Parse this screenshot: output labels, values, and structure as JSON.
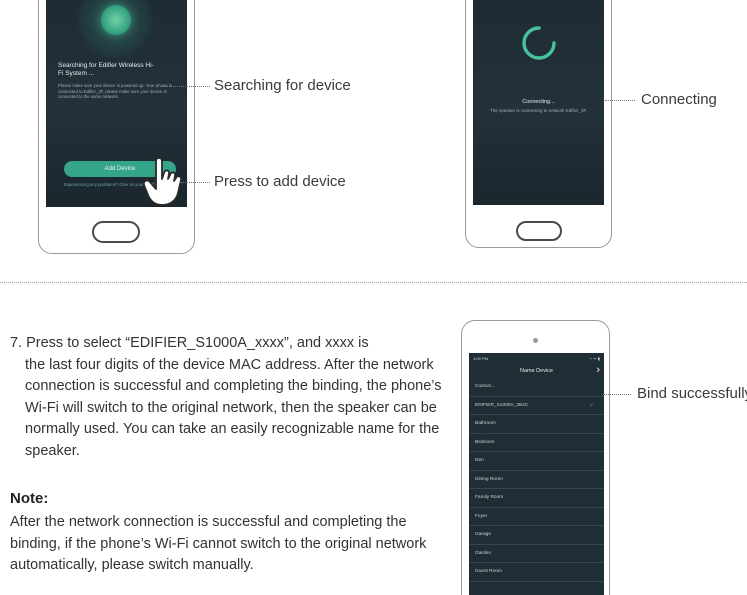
{
  "phone1": {
    "title": "Searching for Edifier Wireless Hi-Fi System ...",
    "description": "Please make sure your device is powered up. Your phone is connected to Edifier_3F, please make sure your device is connected to the same network.",
    "add_button_label": "Add Device",
    "footer": "Experiencing any problems? Give us your feedback >>"
  },
  "phone2": {
    "title": "Connecting...",
    "description": "The speaker is connecting to network Edifier_3F."
  },
  "phone3": {
    "status_time": "1:09 PM",
    "status_icons": "⌁ ᯤ ▮",
    "header": "Name Device",
    "items": [
      {
        "label": "Custom..."
      },
      {
        "label": "EDIFIER_S1000A_2B4C",
        "checked": true
      },
      {
        "label": "Bathroom"
      },
      {
        "label": "Bedroom"
      },
      {
        "label": "Den"
      },
      {
        "label": "Dining Room"
      },
      {
        "label": "Family Room"
      },
      {
        "label": "Foyer"
      },
      {
        "label": "Garage"
      },
      {
        "label": "Garden"
      },
      {
        "label": "Guest Room"
      }
    ]
  },
  "callouts": {
    "searching": "Searching for device",
    "press_add": "Press to add device",
    "connecting": "Connecting",
    "bind": "Bind successfully"
  },
  "instructions": {
    "first_line": "7. Press to select “EDIFIER_S1000A_xxxx”, and xxxx is",
    "rest": "the last four digits of the device MAC address. After the network connection is successful and completing the binding, the phone’s Wi-Fi will switch to the original network, then the speaker can be normally used. You can take an easily recognizable name for the speaker."
  },
  "note": {
    "title": "Note:",
    "body": "After the network connection is successful and completing the binding, if the phone’s Wi-Fi cannot switch to the original network automatically, please switch manually."
  },
  "colors": {
    "screen_bg": "#1e2b33",
    "accent_green": "#35a58a",
    "text_dark": "#333333"
  },
  "icons": {
    "hand": "pointing-hand-icon",
    "check": "check-icon",
    "chevron": "chevron-right-icon"
  }
}
